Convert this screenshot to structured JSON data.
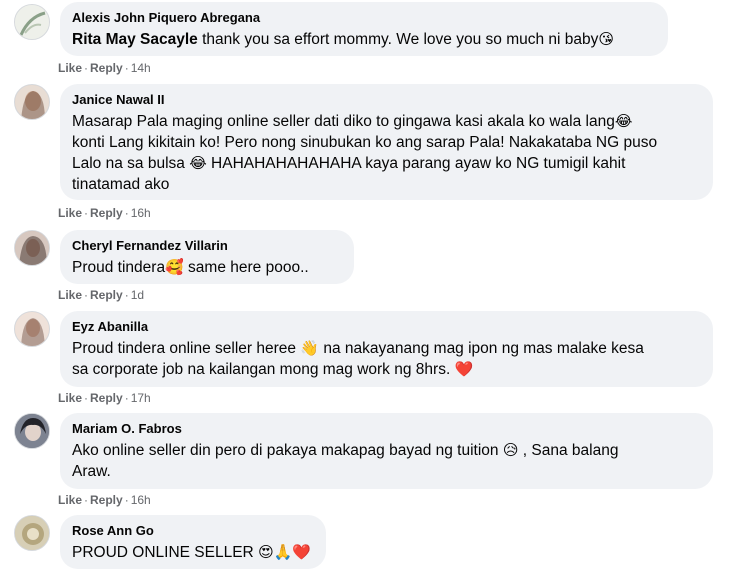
{
  "comments": [
    {
      "author": "Alexis John Piquero Abregana",
      "tag": "Rita May Sacayle",
      "text": " thank you sa effort mommy. We love you so much ni baby",
      "like": "Like",
      "reply": "Reply",
      "time": "14h",
      "emoji_end": "😘"
    },
    {
      "author": "Janice Nawal II",
      "line1": "Masarap Pala maging online seller dati diko to gingawa kasi akala ko wala lang",
      "line2": "konti Lang kikitain ko! Pero nong sinubukan ko ang sarap Pala! Nakakataba NG puso",
      "line3": "Lalo na sa bulsa ",
      "line3b": " HAHAHAHAHAHAHA kaya parang ayaw ko NG tumigil kahit",
      "line4": "tinatamad ako",
      "like": "Like",
      "reply": "Reply",
      "time": "16h",
      "emoji": "😂"
    },
    {
      "author": "Cheryl Fernandez Villarin",
      "text_a": "Proud tindera",
      "text_b": " same here pooo..",
      "like": "Like",
      "reply": "Reply",
      "time": "1d",
      "emoji": "🥰"
    },
    {
      "author": "Eyz Abanilla",
      "line1a": "Proud tindera online seller heree ",
      "line1b": " na nakayanang mag ipon ng mas malake kesa",
      "line2": "sa corporate job na kailangan mong mag work ng 8hrs. ",
      "like": "Like",
      "reply": "Reply",
      "time": "17h",
      "emoji_wave": "👋",
      "emoji_heart": "❤️"
    },
    {
      "author": "Mariam O. Fabros",
      "line1a": "Ako online seller din pero di pakaya makapag bayad ng tuition ",
      "line1b": " , Sana balang",
      "line2": "Araw.",
      "like": "Like",
      "reply": "Reply",
      "time": "16h",
      "emoji": "😥"
    },
    {
      "author": "Rose Ann Go",
      "text": "PROUD ONLINE SELLER ",
      "emoji": "😍🙏❤️"
    }
  ],
  "icons": {
    "reply_connector": "reply-thread-corner-icon"
  }
}
